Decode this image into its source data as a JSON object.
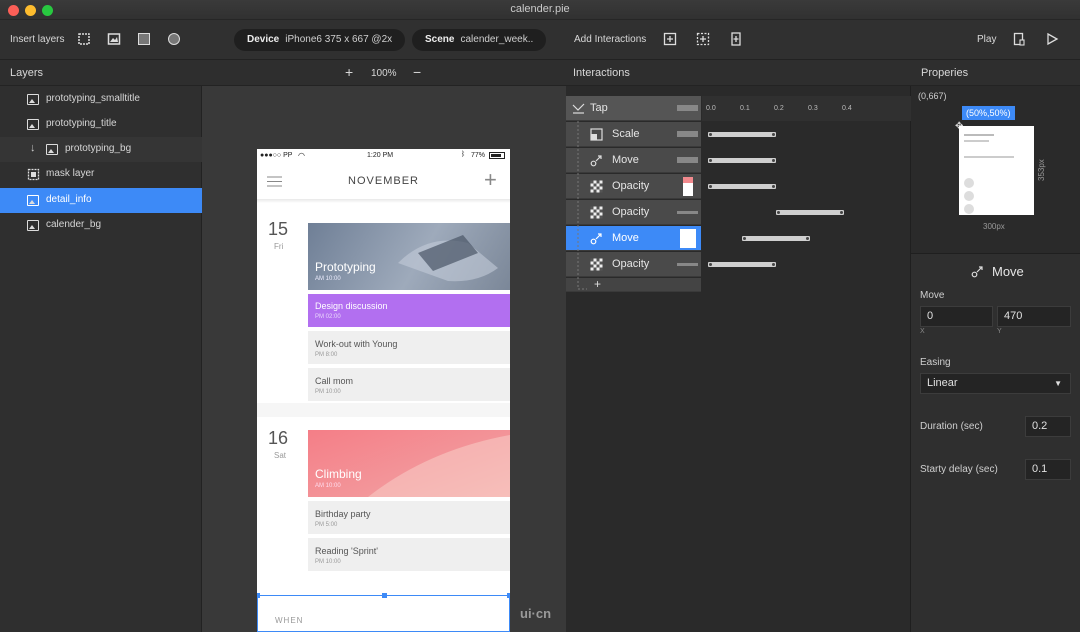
{
  "window": {
    "title": "calender.pie"
  },
  "toolbar": {
    "insert_layers": "Insert layers",
    "device_label": "Device",
    "device_value": "iPhone6  375 x 667 @2x",
    "scene_label": "Scene",
    "scene_value": "calender_week..",
    "add_interactions": "Add Interactions",
    "play": "Play"
  },
  "headers": {
    "layers": "Layers",
    "zoom": "100%",
    "interactions": "Interactions",
    "properties": "Properies"
  },
  "layers": [
    {
      "label": "prototyping_smalltitle"
    },
    {
      "label": "prototyping_title"
    },
    {
      "label": "prototyping_bg"
    },
    {
      "label": "mask layer"
    },
    {
      "label": "detail_info"
    },
    {
      "label": "calender_bg"
    }
  ],
  "phone": {
    "status_carrier": "●●●○○ PP",
    "status_time": "1:20 PM",
    "status_battery": "77%",
    "month": "NOVEMBER",
    "day1": {
      "num": "15",
      "dow": "Fri"
    },
    "day2": {
      "num": "16",
      "dow": "Sat"
    },
    "events1": [
      {
        "title": "Prototyping",
        "time": "AM 10:00"
      },
      {
        "title": "Design discussion",
        "time": "PM 02:00"
      },
      {
        "title": "Work-out with Young",
        "time": "PM 8:00"
      },
      {
        "title": "Call mom",
        "time": "PM 10:00"
      }
    ],
    "events2": [
      {
        "title": "Climbing",
        "time": "AM 10:00"
      },
      {
        "title": "Birthday party",
        "time": "PM 5:00"
      },
      {
        "title": "Reading 'Sprint'",
        "time": "PM 10:00"
      }
    ],
    "when_label": "WHEN"
  },
  "watermark": "ui·cn",
  "interactions": {
    "trigger": "Tap",
    "rows": [
      {
        "label": "Scale",
        "icon": "scale-icon"
      },
      {
        "label": "Move",
        "icon": "move-icon"
      },
      {
        "label": "Opacity",
        "icon": "opacity-icon"
      },
      {
        "label": "Opacity",
        "icon": "opacity-icon"
      },
      {
        "label": "Move",
        "icon": "move-icon"
      },
      {
        "label": "Opacity",
        "icon": "opacity-icon"
      }
    ],
    "add": "+",
    "ticks": [
      "0.0",
      "0.1",
      "0.2",
      "0.3",
      "0.4"
    ],
    "bars": [
      [
        0.0,
        0.2
      ],
      [
        0.0,
        0.2
      ],
      [
        0.0,
        0.2
      ],
      [
        0.2,
        0.4
      ],
      [
        0.1,
        0.3
      ],
      [
        0.0,
        0.2
      ]
    ]
  },
  "properties": {
    "coord": "(0,667)",
    "anchor": "(50%,50%)",
    "height_label": "353px",
    "width_label": "300px",
    "section_title": "Move",
    "move_label": "Move",
    "x_value": "0",
    "y_value": "470",
    "x_caption": "X",
    "y_caption": "Y",
    "easing_label": "Easing",
    "easing_value": "Linear",
    "duration_label": "Duration (sec)",
    "duration_value": "0.2",
    "delay_label": "Starty delay (sec)",
    "delay_value": "0.1"
  },
  "colors": {
    "accent": "#3d8af7",
    "purple": "#b26ff0",
    "coral": "#f28a8e",
    "slate": "#8a9ab0"
  }
}
